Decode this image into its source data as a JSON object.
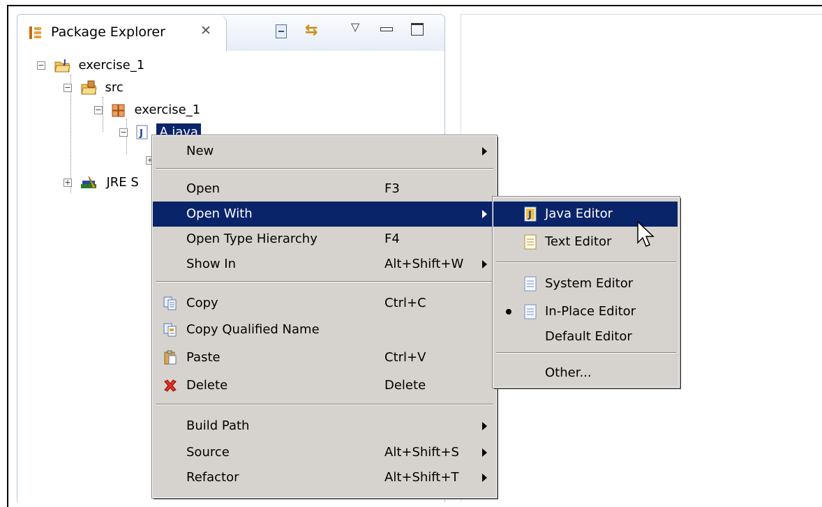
{
  "view": {
    "title": "Package Explorer",
    "close_glyph": "✕",
    "toolbar_icons": [
      "collapse-all-icon",
      "link-with-editor-icon",
      "view-menu-icon",
      "minimize-icon",
      "maximize-icon"
    ]
  },
  "tree": {
    "project": "exercise_1",
    "src": "src",
    "package": "exercise_1",
    "selected_partial": "A.java",
    "jre": "JRE S"
  },
  "menu": {
    "items": {
      "new": "New",
      "open": "Open",
      "open_acc": "F3",
      "open_with": "Open With",
      "open_type_hierarchy": "Open Type Hierarchy",
      "open_type_hierarchy_acc": "F4",
      "show_in": "Show In",
      "show_in_acc": "Alt+Shift+W",
      "copy": "Copy",
      "copy_acc": "Ctrl+C",
      "copy_qualified": "Copy Qualified Name",
      "paste": "Paste",
      "paste_acc": "Ctrl+V",
      "delete": "Delete",
      "delete_acc": "Delete",
      "build_path": "Build Path",
      "source": "Source",
      "source_acc": "Alt+Shift+S",
      "refactor": "Refactor",
      "refactor_acc": "Alt+Shift+T"
    }
  },
  "submenu": {
    "java_editor": "Java Editor",
    "text_editor": "Text Editor",
    "system_editor": "System Editor",
    "inplace_editor": "In-Place Editor",
    "default_editor": "Default Editor",
    "other": "Other..."
  },
  "colors": {
    "selection": "#0a246a",
    "menu_bg": "#d6d3ce",
    "view_border": "#b4c3d8"
  }
}
